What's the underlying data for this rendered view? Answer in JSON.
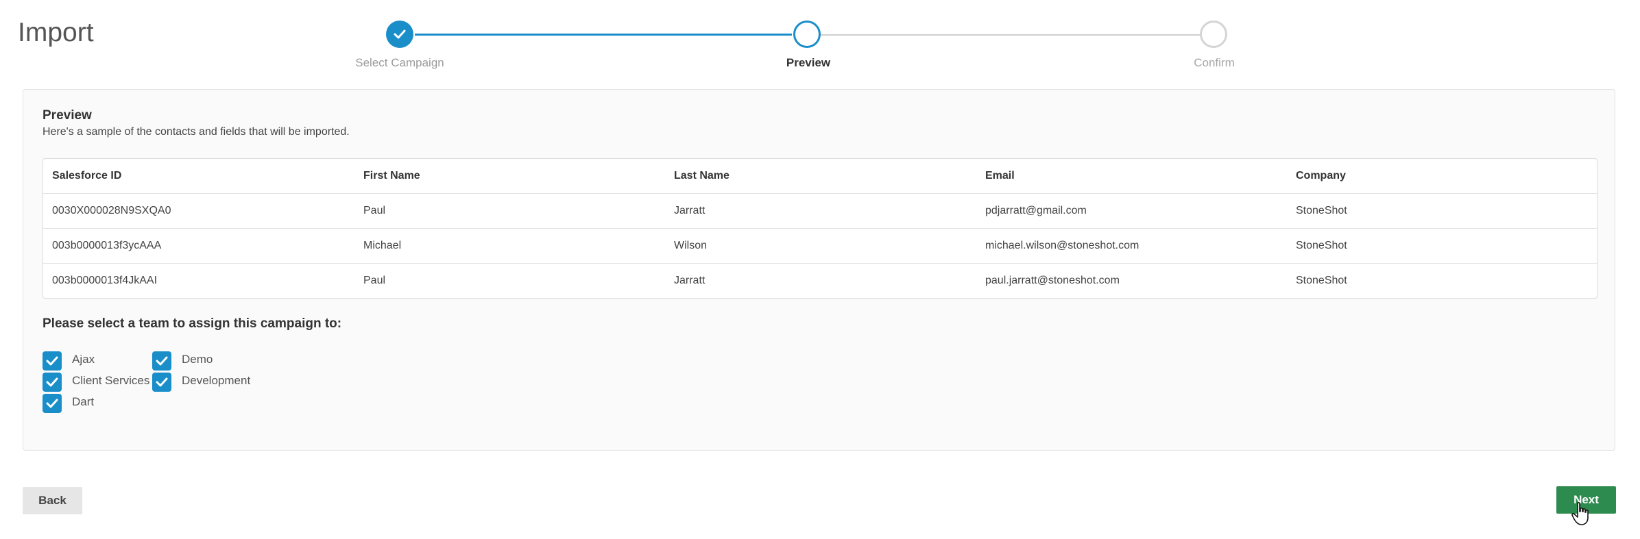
{
  "page": {
    "title": "Import"
  },
  "stepper": {
    "steps": [
      {
        "label": "Select Campaign",
        "state": "completed"
      },
      {
        "label": "Preview",
        "state": "current"
      },
      {
        "label": "Confirm",
        "state": "upcoming"
      }
    ],
    "accent_color": "#1a8ec9"
  },
  "preview": {
    "title": "Preview",
    "subtitle": "Here's a sample of the contacts and fields that will be imported.",
    "columns": [
      "Salesforce ID",
      "First Name",
      "Last Name",
      "Email",
      "Company"
    ],
    "rows": [
      [
        "0030X000028N9SXQA0",
        "Paul",
        "Jarratt",
        "pdjarratt@gmail.com",
        "StoneShot"
      ],
      [
        "003b0000013f3ycAAA",
        "Michael",
        "Wilson",
        "michael.wilson@stoneshot.com",
        "StoneShot"
      ],
      [
        "003b0000013f4JkAAI",
        "Paul",
        "Jarratt",
        "paul.jarratt@stoneshot.com",
        "StoneShot"
      ]
    ]
  },
  "teams": {
    "heading": "Please select a team to assign this campaign to:",
    "options": [
      {
        "label": "Ajax",
        "checked": true
      },
      {
        "label": "Demo",
        "checked": true
      },
      {
        "label": "Client Services",
        "checked": true
      },
      {
        "label": "Development",
        "checked": true
      },
      {
        "label": "Dart",
        "checked": true
      }
    ]
  },
  "actions": {
    "back_label": "Back",
    "next_label": "Next",
    "next_color": "#2e8b4f"
  }
}
